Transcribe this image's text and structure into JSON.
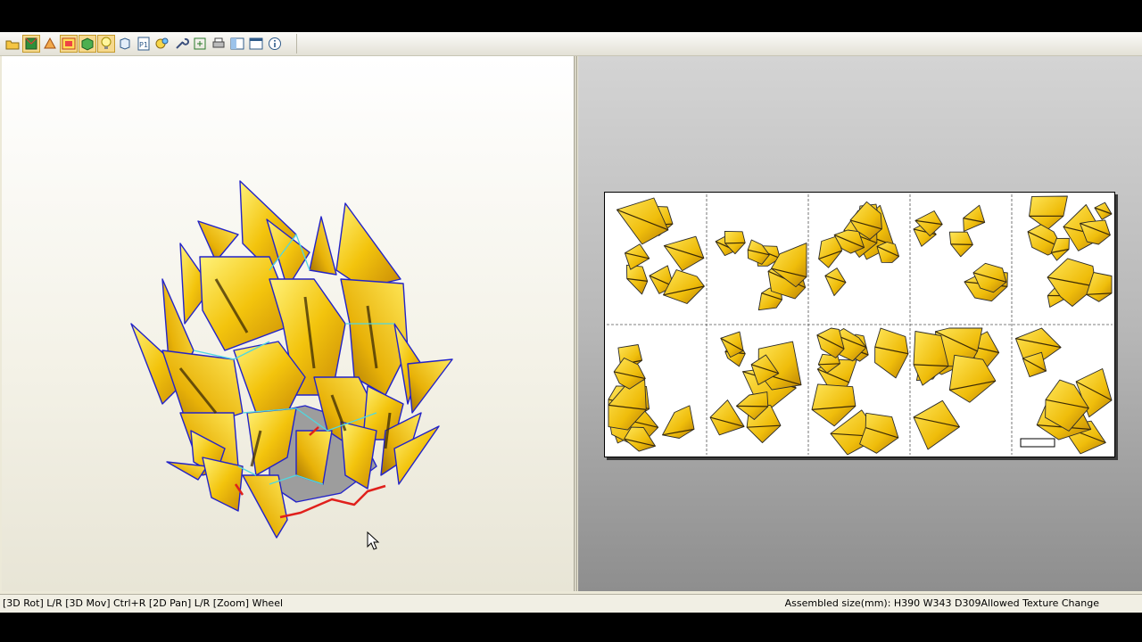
{
  "toolbar": {
    "buttons": [
      {
        "name": "open-icon",
        "active": false
      },
      {
        "name": "3d-model-icon",
        "active": true
      },
      {
        "name": "edge-tool-icon",
        "active": false
      },
      {
        "name": "texture-icon",
        "active": true
      },
      {
        "name": "cube-view-icon",
        "active": true
      },
      {
        "name": "light-bulb-icon",
        "active": true
      },
      {
        "name": "3d-cube-icon",
        "active": false
      },
      {
        "name": "page-p1-icon",
        "active": false
      },
      {
        "name": "paint-icon",
        "active": false
      },
      {
        "name": "wrench-icon",
        "active": false
      },
      {
        "name": "zoom-fit-icon",
        "active": false
      },
      {
        "name": "print-icon",
        "active": false
      },
      {
        "name": "window-left-icon",
        "active": false
      },
      {
        "name": "window-single-icon",
        "active": false
      },
      {
        "name": "info-icon",
        "active": false
      }
    ],
    "page_label": "P1"
  },
  "statusbar": {
    "hint": "[3D Rot] L/R [3D Mov] Ctrl+R [2D Pan] L/R [Zoom] Wheel",
    "info": "Assembled size(mm): H390 W343 D309Allowed Texture Change"
  },
  "colors": {
    "part_fill": "#f2c40c",
    "part_edge_3d": "#2323c8",
    "fold_line": "#4fd8e0",
    "cut_edge": "#e0201c"
  }
}
